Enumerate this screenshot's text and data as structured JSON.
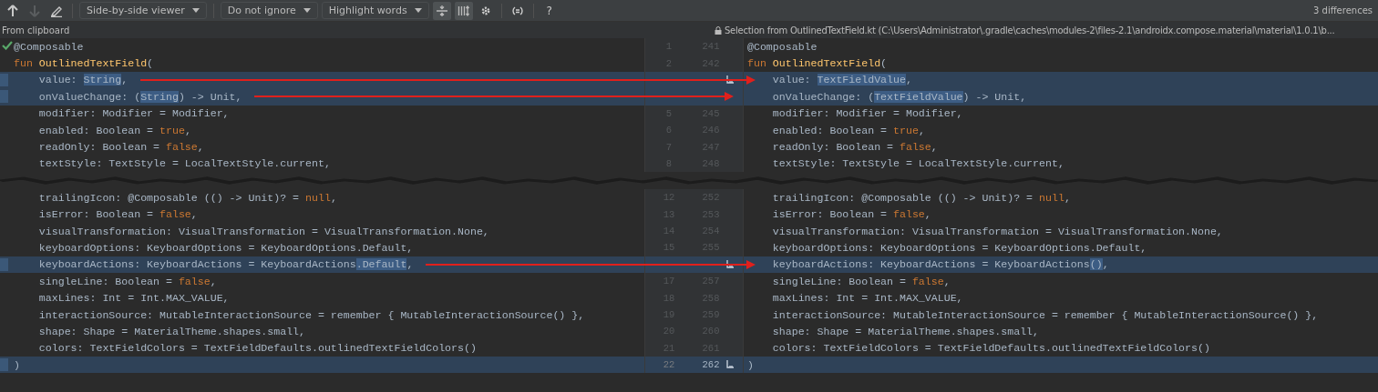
{
  "toolbar": {
    "previous_disabled": false,
    "next_disabled": true,
    "dropdowns": [
      {
        "label": "Side-by-side viewer"
      },
      {
        "label": "Do not ignore"
      },
      {
        "label": "Highlight words"
      }
    ],
    "toggles": [
      {
        "selected": true
      },
      {
        "selected": true
      }
    ],
    "help": "?",
    "differences": "3 differences"
  },
  "info": {
    "left": "From clipboard",
    "right": "Selection from OutlinedTextField.kt (C:\\Users\\Administrator\\.gradle\\caches\\modules-2\\files-2.1\\androidx.compose.material\\material\\1.0.1\\b..."
  },
  "rows": [
    {
      "kind": "line",
      "changed": false,
      "check": true,
      "left_number": "1",
      "right_number": "241",
      "left": [
        {
          "text": "@Composable",
          "kind": "plain"
        }
      ],
      "right": [
        {
          "text": "@Composable",
          "kind": "plain"
        }
      ]
    },
    {
      "kind": "line",
      "changed": false,
      "left_number": "2",
      "right_number": "242",
      "left": [
        {
          "text": "fun",
          "kind": "keyword"
        },
        {
          "text": "OutlinedTextField",
          "kind": "function"
        },
        {
          "text": "(",
          "kind": "plain"
        }
      ],
      "right": [
        {
          "text": "fun",
          "kind": "keyword"
        },
        {
          "text": "OutlinedTextField",
          "kind": "function"
        },
        {
          "text": "(",
          "kind": "plain"
        }
      ]
    },
    {
      "kind": "line",
      "changed": true,
      "apply_icon": true,
      "arrow": true,
      "left": [
        {
          "text": "    value: ",
          "kind": "plain"
        },
        {
          "text": "String",
          "kind": "diff"
        },
        {
          "text": ",",
          "kind": "plain"
        }
      ],
      "right": [
        {
          "text": "    value: ",
          "kind": "plain"
        },
        {
          "text": "TextFieldValue",
          "kind": "diff"
        },
        {
          "text": ",",
          "kind": "plain"
        }
      ]
    },
    {
      "kind": "line",
      "changed": true,
      "arrow": true,
      "left": [
        {
          "text": "    onValueChange: (",
          "kind": "plain"
        },
        {
          "text": "String",
          "kind": "diff"
        },
        {
          "text": ") -> Unit,",
          "kind": "plain"
        }
      ],
      "right": [
        {
          "text": "    onValueChange: (",
          "kind": "plain"
        },
        {
          "text": "TextFieldValue",
          "kind": "diff"
        },
        {
          "text": ") -> Unit,",
          "kind": "plain"
        }
      ]
    },
    {
      "kind": "line",
      "changed": false,
      "left_number": "5",
      "right_number": "245",
      "left": [
        {
          "text": "    modifier: Modifier = Modifier,",
          "kind": "plain"
        }
      ],
      "right": [
        {
          "text": "    modifier: Modifier = Modifier,",
          "kind": "plain"
        }
      ]
    },
    {
      "kind": "line",
      "changed": false,
      "left_number": "6",
      "right_number": "246",
      "left": [
        {
          "text": "    enabled: Boolean = ",
          "kind": "plain"
        },
        {
          "text": "true",
          "kind": "keyword"
        },
        {
          "text": ",",
          "kind": "plain"
        }
      ],
      "right": [
        {
          "text": "    enabled: Boolean = ",
          "kind": "plain"
        },
        {
          "text": "true",
          "kind": "keyword"
        },
        {
          "text": ",",
          "kind": "plain"
        }
      ]
    },
    {
      "kind": "line",
      "changed": false,
      "left_number": "7",
      "right_number": "247",
      "left": [
        {
          "text": "    readOnly: Boolean = ",
          "kind": "plain"
        },
        {
          "text": "false",
          "kind": "keyword"
        },
        {
          "text": ",",
          "kind": "plain"
        }
      ],
      "right": [
        {
          "text": "    readOnly: Boolean = ",
          "kind": "plain"
        },
        {
          "text": "false",
          "kind": "keyword"
        },
        {
          "text": ",",
          "kind": "plain"
        }
      ]
    },
    {
      "kind": "line",
      "changed": false,
      "left_number": "8",
      "right_number": "248",
      "left": [
        {
          "text": "    textStyle: TextStyle = LocalTextStyle.current,",
          "kind": "plain"
        }
      ],
      "right": [
        {
          "text": "    textStyle: TextStyle = LocalTextStyle.current,",
          "kind": "plain"
        }
      ]
    },
    {
      "kind": "fold"
    },
    {
      "kind": "line",
      "changed": false,
      "left_number": "12",
      "right_number": "252",
      "left": [
        {
          "text": "    trailingIcon: @Composable (() -> Unit)? = ",
          "kind": "plain"
        },
        {
          "text": "null",
          "kind": "keyword"
        },
        {
          "text": ",",
          "kind": "plain"
        }
      ],
      "right": [
        {
          "text": "    trailingIcon: @Composable (() -> Unit)? = ",
          "kind": "plain"
        },
        {
          "text": "null",
          "kind": "keyword"
        },
        {
          "text": ",",
          "kind": "plain"
        }
      ]
    },
    {
      "kind": "line",
      "changed": false,
      "left_number": "13",
      "right_number": "253",
      "left": [
        {
          "text": "    isError: Boolean = ",
          "kind": "plain"
        },
        {
          "text": "false",
          "kind": "keyword"
        },
        {
          "text": ",",
          "kind": "plain"
        }
      ],
      "right": [
        {
          "text": "    isError: Boolean = ",
          "kind": "plain"
        },
        {
          "text": "false",
          "kind": "keyword"
        },
        {
          "text": ",",
          "kind": "plain"
        }
      ]
    },
    {
      "kind": "line",
      "changed": false,
      "left_number": "14",
      "right_number": "254",
      "left": [
        {
          "text": "    visualTransformation: VisualTransformation = VisualTransformation.None,",
          "kind": "plain"
        }
      ],
      "right": [
        {
          "text": "    visualTransformation: VisualTransformation = VisualTransformation.None,",
          "kind": "plain"
        }
      ]
    },
    {
      "kind": "line",
      "changed": false,
      "left_number": "15",
      "right_number": "255",
      "left": [
        {
          "text": "    keyboardOptions: KeyboardOptions = KeyboardOptions.Default,",
          "kind": "plain"
        }
      ],
      "right": [
        {
          "text": "    keyboardOptions: KeyboardOptions = KeyboardOptions.Default,",
          "kind": "plain"
        }
      ]
    },
    {
      "kind": "line",
      "changed": true,
      "apply_icon": true,
      "arrow": true,
      "left": [
        {
          "text": "    keyboardActions: KeyboardActions = KeyboardActions",
          "kind": "plain"
        },
        {
          "text": ".Default",
          "kind": "diff"
        },
        {
          "text": ",",
          "kind": "plain"
        }
      ],
      "right": [
        {
          "text": "    keyboardActions: KeyboardActions = KeyboardActions",
          "kind": "plain"
        },
        {
          "text": "()",
          "kind": "diff"
        },
        {
          "text": ",",
          "kind": "plain"
        }
      ]
    },
    {
      "kind": "line",
      "changed": false,
      "left_number": "17",
      "right_number": "257",
      "left": [
        {
          "text": "    singleLine: Boolean = ",
          "kind": "plain"
        },
        {
          "text": "false",
          "kind": "keyword"
        },
        {
          "text": ",",
          "kind": "plain"
        }
      ],
      "right": [
        {
          "text": "    singleLine: Boolean = ",
          "kind": "plain"
        },
        {
          "text": "false",
          "kind": "keyword"
        },
        {
          "text": ",",
          "kind": "plain"
        }
      ]
    },
    {
      "kind": "line",
      "changed": false,
      "left_number": "18",
      "right_number": "258",
      "left": [
        {
          "text": "    maxLines: Int = Int.MAX_VALUE,",
          "kind": "plain"
        }
      ],
      "right": [
        {
          "text": "    maxLines: Int = Int.MAX_VALUE,",
          "kind": "plain"
        }
      ]
    },
    {
      "kind": "line",
      "changed": false,
      "left_number": "19",
      "right_number": "259",
      "left": [
        {
          "text": "    interactionSource: MutableInteractionSource = remember { MutableInteractionSource() },",
          "kind": "plain"
        }
      ],
      "right": [
        {
          "text": "    interactionSource: MutableInteractionSource = remember { MutableInteractionSource() },",
          "kind": "plain"
        }
      ]
    },
    {
      "kind": "line",
      "changed": false,
      "left_number": "20",
      "right_number": "260",
      "left": [
        {
          "text": "    shape: Shape = MaterialTheme.shapes.small,",
          "kind": "plain"
        }
      ],
      "right": [
        {
          "text": "    shape: Shape = MaterialTheme.shapes.small,",
          "kind": "plain"
        }
      ]
    },
    {
      "kind": "line",
      "changed": false,
      "left_number": "21",
      "right_number": "261",
      "left": [
        {
          "text": "    colors: TextFieldColors = TextFieldDefaults.outlinedTextFieldColors()",
          "kind": "plain"
        }
      ],
      "right": [
        {
          "text": "    colors: TextFieldColors = TextFieldDefaults.outlinedTextFieldColors()",
          "kind": "plain"
        }
      ]
    },
    {
      "kind": "line",
      "changed": true,
      "apply_icon": true,
      "left_number": "22",
      "right_number": "262",
      "left": [
        {
          "text": ")",
          "kind": "plain"
        }
      ],
      "right": [
        {
          "text": ")",
          "kind": "plain"
        }
      ]
    }
  ]
}
